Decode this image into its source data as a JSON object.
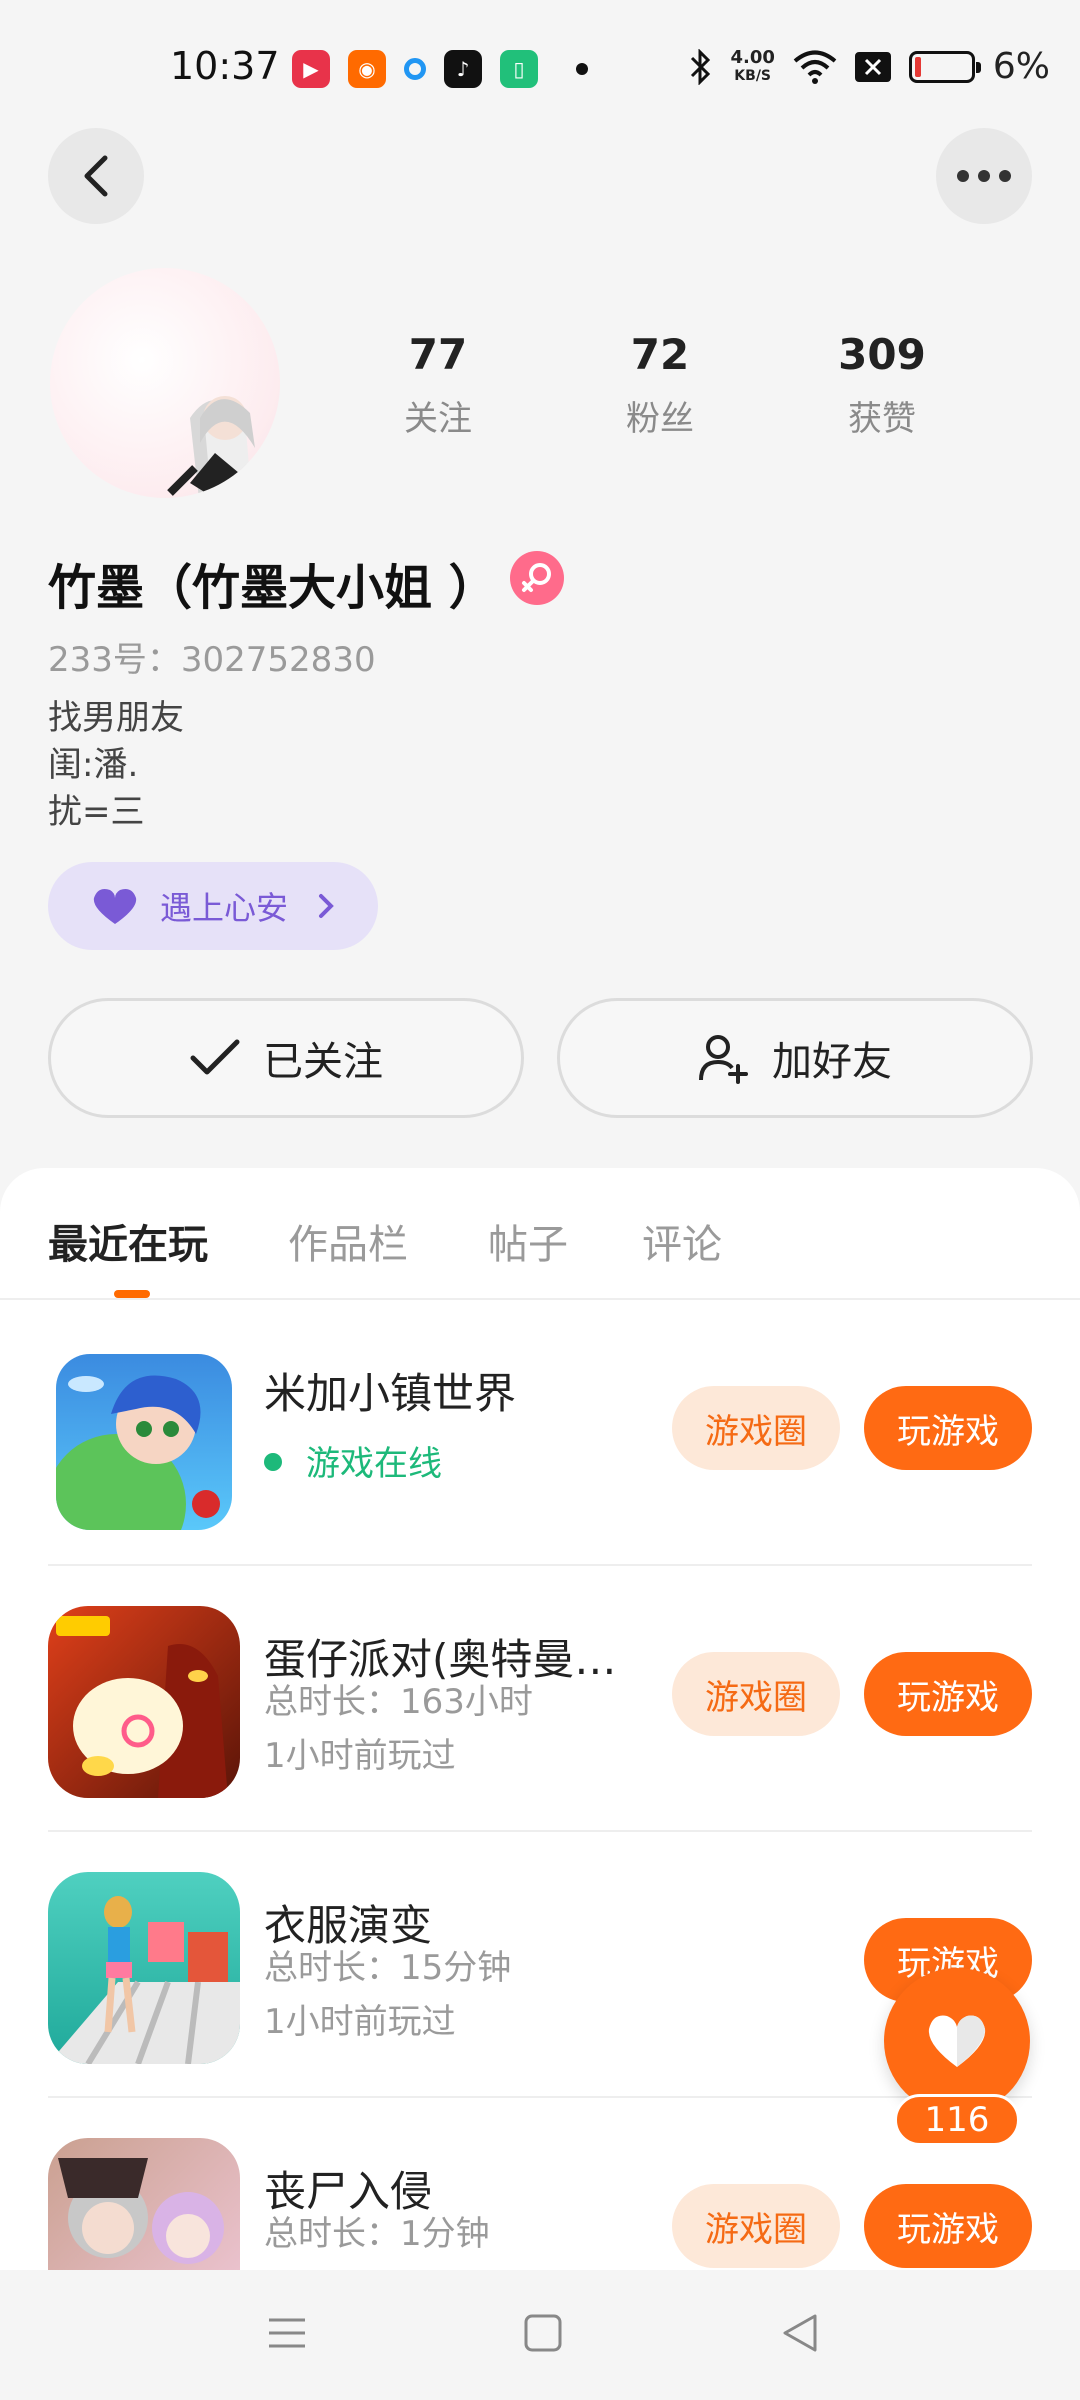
{
  "status_bar": {
    "time": "10:37",
    "network_speed_top": "4.00",
    "network_speed_bottom": "KB/S",
    "battery": "6%",
    "notification_icons": [
      "video-app-icon",
      "kuaishou-icon",
      "browser-dot-icon",
      "tiktok-icon",
      "phone-clean-icon"
    ]
  },
  "profile": {
    "stats": [
      {
        "value": "77",
        "label": "关注"
      },
      {
        "value": "72",
        "label": "粉丝"
      },
      {
        "value": "309",
        "label": "获赞"
      }
    ],
    "name": "竹墨（竹墨大小姐 ）",
    "uid": "233号：302752830",
    "bio": [
      "找男朋友",
      "闺:潘.",
      "扰=三"
    ],
    "tag": "遇上心安"
  },
  "actions": {
    "followed": "已关注",
    "add_friend": "加好友"
  },
  "tabs": [
    "最近在玩",
    "作品栏",
    "帖子",
    "评论"
  ],
  "games": [
    {
      "name": "米加小镇世界",
      "line1": "游戏在线",
      "line2": "",
      "online": true,
      "circle": "游戏圈",
      "play": "玩游戏"
    },
    {
      "name": "蛋仔派对(奥特曼联…",
      "line1": "总时长：163小时",
      "line2": "1小时前玩过",
      "online": false,
      "circle": "游戏圈",
      "play": "玩游戏"
    },
    {
      "name": "衣服演变",
      "line1": "总时长：15分钟",
      "line2": "1小时前玩过",
      "online": false,
      "circle": "",
      "play": "玩游戏"
    },
    {
      "name": "丧尸入侵",
      "line1": "总时长：1分钟",
      "line2": "",
      "online": false,
      "circle": "游戏圈",
      "play": "玩游戏"
    }
  ],
  "like_count": "116",
  "colors": {
    "accent": "#ff6a13",
    "online": "#1db97a",
    "tag_text": "#7a5ad6"
  }
}
